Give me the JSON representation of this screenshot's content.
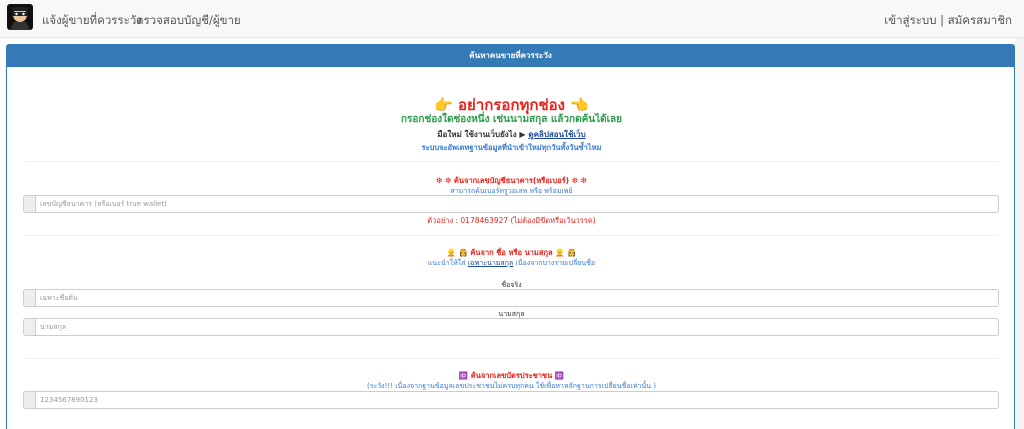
{
  "nav": {
    "left_items": [
      "แจ้งผู้ขายที่ควรระวัง",
      "ตรวจสอบบัญชี/ผู้ขาย"
    ],
    "right_text": "เข้าสู่ระบบ | สมัครสมาชิก"
  },
  "panel": {
    "heading": "ค้นหาคนขายที่ควรระวัง",
    "warning_title": "👉 อย่ากรอกทุกช่อง 👈",
    "warning_sub": "กรอกช่องใดช่องหนึ่ง เช่นนามสกุล แล้วกดค้นได้เลย",
    "newbie_text": "มือใหม่ ใช้งานเว็บยังไง ▶",
    "newbie_link": "ดูคลิปสอนใช้เว็บ",
    "system_note": "ระบบจะอัพเดทฐานข้อมูลที่นำเข้าใหม่ทุกวันทั้งวันซ้ำไหม"
  },
  "bank_section": {
    "title": "❇ ❇ ค้นจากเลขบัญชีธนาคาร(หรือเบอร์) ❇ ❇",
    "subtitle": "สามารถค้นเบอร์ทรูวอเลท หรือ พร้อมเพย์",
    "placeholder": "เลขบัญชีธนาคาร (หรือเบอร์ true wallet)",
    "example": "ตัวอย่าง : 0178463927 (ไม่ต้องมีขีดหรือเว้นวรรค)"
  },
  "name_section": {
    "title": "👱 👸 ค้นจาก ชื่อ หรือ นามสกุล 👱 👸",
    "subtitle_prefix": "แนะนำให้ใส่",
    "subtitle_link": "เฉพาะนามสกุล",
    "subtitle_suffix": "เนื่องจากบางรายเปลี่ยนชื่อ",
    "first_label": "ชื่อจริง",
    "first_placeholder": "เฉพาะชื่อต้น",
    "last_label": "นามสกุล",
    "last_placeholder": "นามสกุล"
  },
  "id_section": {
    "title": "🆔 ค้นจากเลขบัตรประชาชน 🆔",
    "subtitle": "(ระวัง!!! เนื่องจากฐานข้อมูลเลขประชาชนไม่ครบทุกคน ใช้เพื่อหาหลักฐานการเปลี่ยนชื่อเท่านั้น )",
    "placeholder": "1234567890123"
  },
  "colors": {
    "primary": "#337ab7",
    "danger": "#e8221b",
    "success": "#2e9b4a",
    "info": "#3a7bd5"
  }
}
